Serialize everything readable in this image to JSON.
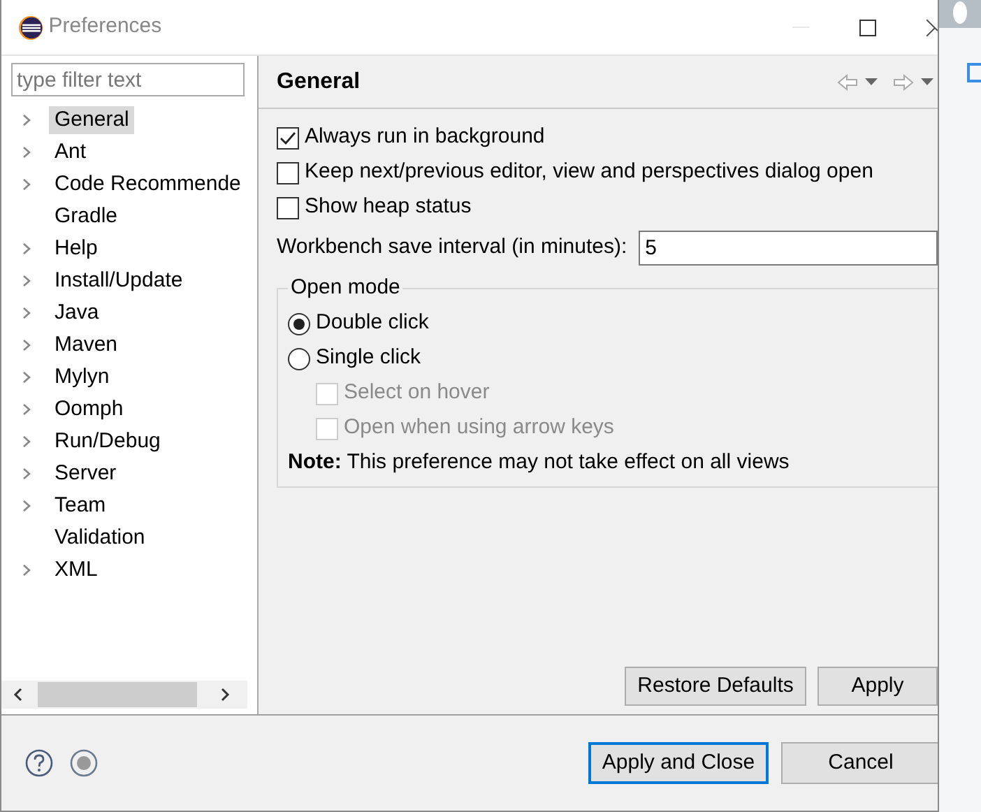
{
  "window": {
    "title": "Preferences"
  },
  "filter": {
    "placeholder": "type filter text"
  },
  "tree": [
    {
      "label": "General",
      "expandable": true,
      "selected": true
    },
    {
      "label": "Ant",
      "expandable": true,
      "selected": false
    },
    {
      "label": "Code Recommende",
      "expandable": true,
      "selected": false
    },
    {
      "label": "Gradle",
      "expandable": false,
      "selected": false
    },
    {
      "label": "Help",
      "expandable": true,
      "selected": false
    },
    {
      "label": "Install/Update",
      "expandable": true,
      "selected": false
    },
    {
      "label": "Java",
      "expandable": true,
      "selected": false
    },
    {
      "label": "Maven",
      "expandable": true,
      "selected": false
    },
    {
      "label": "Mylyn",
      "expandable": true,
      "selected": false
    },
    {
      "label": "Oomph",
      "expandable": true,
      "selected": false
    },
    {
      "label": "Run/Debug",
      "expandable": true,
      "selected": false
    },
    {
      "label": "Server",
      "expandable": true,
      "selected": false
    },
    {
      "label": "Team",
      "expandable": true,
      "selected": false
    },
    {
      "label": "Validation",
      "expandable": false,
      "selected": false
    },
    {
      "label": "XML",
      "expandable": true,
      "selected": false
    }
  ],
  "page": {
    "title": "General",
    "options": [
      {
        "label": "Always run in background",
        "checked": true
      },
      {
        "label": "Keep next/previous editor, view and perspectives dialog open",
        "checked": false
      },
      {
        "label": "Show heap status",
        "checked": false
      }
    ],
    "save_interval": {
      "label": "Workbench save interval (in minutes):",
      "value": "5"
    },
    "open_mode": {
      "title": "Open mode",
      "choices": [
        {
          "label": "Double click",
          "selected": true
        },
        {
          "label": "Single click",
          "selected": false
        }
      ],
      "sub_options": [
        {
          "label": "Select on hover",
          "checked": false,
          "disabled": true
        },
        {
          "label": "Open when using arrow keys",
          "checked": false,
          "disabled": true
        }
      ],
      "note": "**Note:** This preference may not take effect on all views"
    },
    "buttons": [
      "Restore Defaults",
      "Apply"
    ]
  },
  "footer": {
    "buttons": [
      {
        "label": "Apply and Close",
        "default": true
      },
      {
        "label": "Cancel",
        "default": false
      }
    ]
  }
}
